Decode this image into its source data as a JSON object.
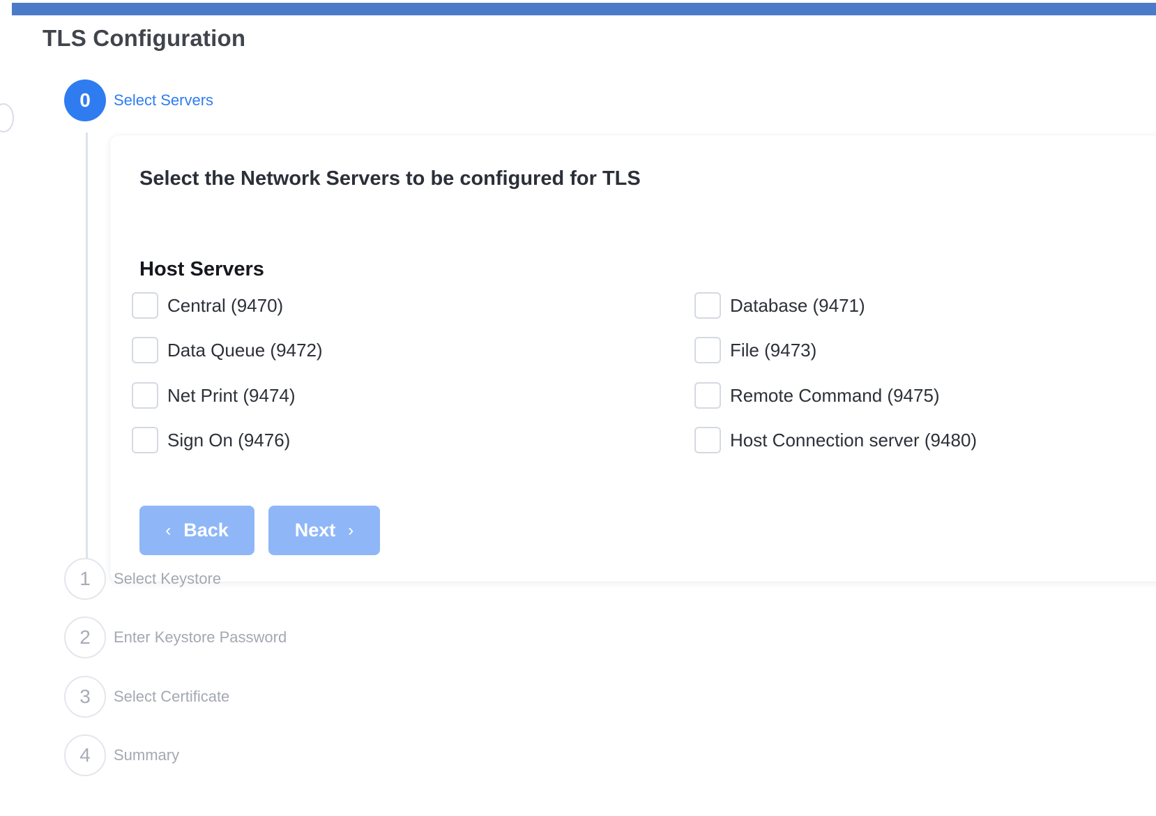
{
  "page": {
    "title": "TLS Configuration",
    "accent_color": "#2f7cf0",
    "top_bar_color": "#4b7bc8"
  },
  "steps": [
    {
      "number": "0",
      "label": "Select Servers",
      "state": "active"
    },
    {
      "number": "1",
      "label": "Select Keystore",
      "state": "inactive"
    },
    {
      "number": "2",
      "label": "Enter Keystore Password",
      "state": "inactive"
    },
    {
      "number": "3",
      "label": "Select Certificate",
      "state": "inactive"
    },
    {
      "number": "4",
      "label": "Summary",
      "state": "inactive"
    }
  ],
  "panel": {
    "heading": "Select the Network Servers to be configured for TLS",
    "section_heading": "Host Servers",
    "servers": [
      {
        "label": "Central (9470)",
        "checked": false
      },
      {
        "label": "Database (9471)",
        "checked": false
      },
      {
        "label": "Data Queue (9472)",
        "checked": false
      },
      {
        "label": "File (9473)",
        "checked": false
      },
      {
        "label": "Net Print (9474)",
        "checked": false
      },
      {
        "label": "Remote Command (9475)",
        "checked": false
      },
      {
        "label": "Sign On (9476)",
        "checked": false
      },
      {
        "label": "Host Connection server (9480)",
        "checked": false
      }
    ],
    "buttons": {
      "back_label": "Back",
      "back_icon": "chevron-left-icon",
      "next_label": "Next",
      "next_icon": "chevron-right-icon",
      "button_color": "#8fb7f7"
    }
  }
}
